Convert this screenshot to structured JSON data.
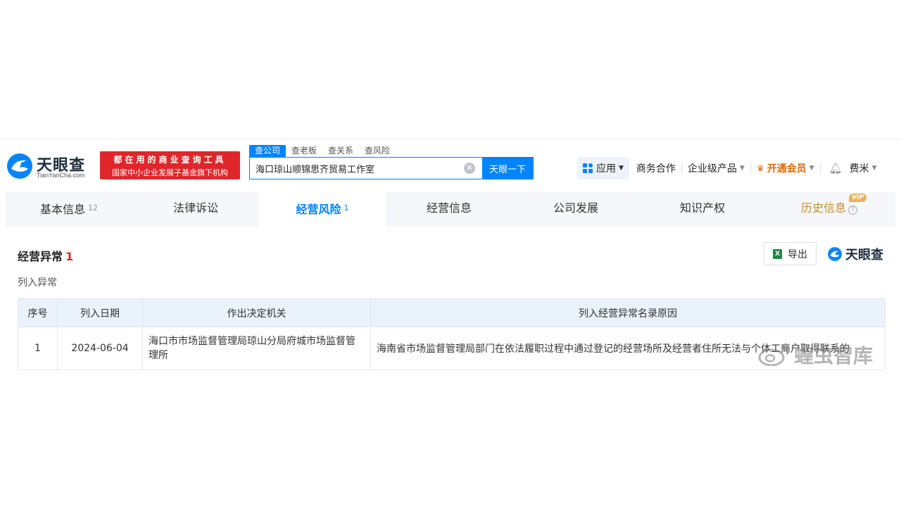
{
  "header": {
    "logo_name": "天眼查",
    "logo_url": "TianYanCha.com",
    "slogan_line1": "都在用的商业查询工具",
    "slogan_line2": "国家中小企业发展子基金旗下机构",
    "search_tabs": [
      "查公司",
      "查老板",
      "查关系",
      "查风险"
    ],
    "search_value": "海口琼山顺锦思齐贸易工作室",
    "search_button": "天眼一下",
    "nav": {
      "apps": "应用",
      "business": "商务合作",
      "enterprise": "企业级产品",
      "vip": "开通会员",
      "user": "费米"
    }
  },
  "tabs": [
    {
      "label": "基本信息",
      "count": "12"
    },
    {
      "label": "法律诉讼",
      "count": ""
    },
    {
      "label": "经营风险",
      "count": "1"
    },
    {
      "label": "经营信息",
      "count": ""
    },
    {
      "label": "公司发展",
      "count": ""
    },
    {
      "label": "知识产权",
      "count": ""
    },
    {
      "label": "历史信息",
      "count": "",
      "badge": "VIP"
    }
  ],
  "section": {
    "title": "经营异常",
    "count": "1",
    "subtitle": "列入异常",
    "export": "导出",
    "brand": "天眼查"
  },
  "table": {
    "headers": [
      "序号",
      "列入日期",
      "作出决定机关",
      "列入经营异常名录原因"
    ],
    "rows": [
      {
        "index": "1",
        "date": "2024-06-04",
        "authority": "海口市市场监督管理局琼山分局府城市场监督管理所",
        "reason": "海南省市场监督管理局部门在依法履职过程中通过登记的经营场所及经营者住所无法与个体工商户取得联系的"
      }
    ]
  },
  "watermark": "蝗虫智库",
  "colors": {
    "accent": "#0084ff",
    "slogan_bg": "#e0262b",
    "vip": "#e06a00"
  }
}
